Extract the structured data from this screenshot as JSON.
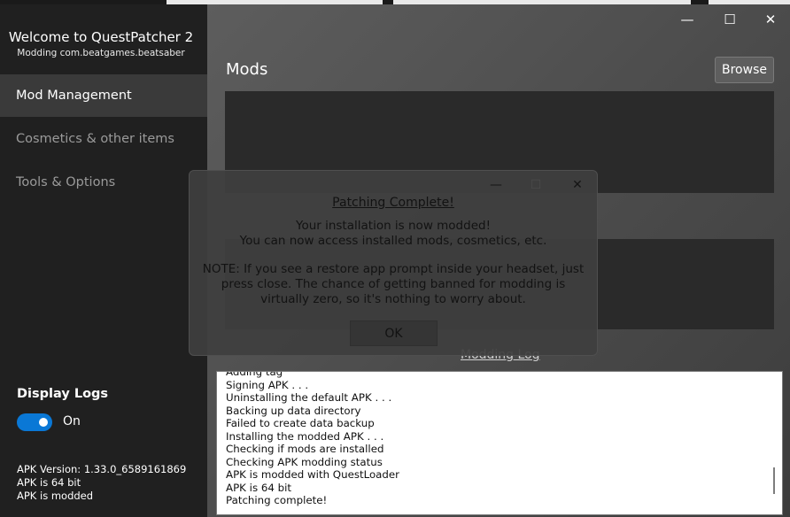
{
  "app": {
    "title": "Welcome to QuestPatcher 2",
    "subtitle": "Modding com.beatgames.beatsaber"
  },
  "sidebar": {
    "items": [
      {
        "label": "Mod Management",
        "active": true
      },
      {
        "label": "Cosmetics & other items",
        "active": false
      },
      {
        "label": "Tools & Options",
        "active": false
      }
    ],
    "display_logs_label": "Display Logs",
    "toggle_state": "On",
    "apk_version": "APK Version: 1.33.0_6589161869",
    "apk_bits": "APK is 64 bit",
    "apk_status": "APK is modded"
  },
  "window_controls": {
    "minimize": "—",
    "maximize": "☐",
    "close": "✕"
  },
  "main": {
    "section_title": "Mods",
    "browse_label": "Browse",
    "modding_log_heading": "Modding Log"
  },
  "log": {
    "lines": [
      "Adding tag",
      "Signing APK . . .",
      "Uninstalling the default APK . . .",
      "Backing up data directory",
      "Failed to create data backup",
      "Installing the modded APK . . .",
      "Checking if mods are installed",
      "Checking APK modding status",
      "APK is modded with QuestLoader",
      "APK is 64 bit",
      "Patching complete!"
    ]
  },
  "dialog": {
    "title": "Patching Complete!",
    "line1": "Your installation is now modded!",
    "line2": "You can now access installed mods, cosmetics, etc.",
    "note": "NOTE: If you see a restore app prompt inside your headset, just press close. The chance of getting banned for modding is virtually zero, so it's nothing to worry about.",
    "ok_label": "OK",
    "controls": {
      "minimize": "—",
      "maximize": "☐",
      "close": "✕"
    }
  },
  "colors": {
    "sidebar_bg": "#202020",
    "active_item_bg": "#3a3a3a",
    "toggle_accent": "#0a78d6",
    "panel_bg": "#2a2a2a",
    "log_bg": "#ffffff"
  }
}
